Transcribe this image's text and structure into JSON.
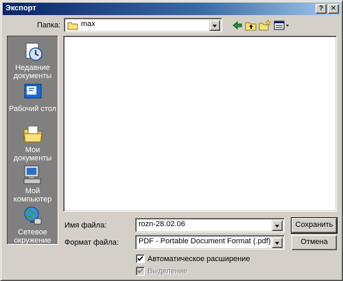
{
  "window": {
    "title": "Экспорт",
    "help_icon": "?",
    "close_icon": "✕"
  },
  "lookin": {
    "label": "Папка:",
    "value": "max",
    "icon": "folder-icon"
  },
  "toolbar": {
    "icons": [
      "back-arrow-icon",
      "up-folder-icon",
      "new-folder-icon",
      "view-menu-icon"
    ]
  },
  "places": [
    {
      "label": "Недавние документы",
      "icon": "recent-documents-icon"
    },
    {
      "label": "Рабочий стол",
      "icon": "desktop-icon"
    },
    {
      "label": "Мои документы",
      "icon": "my-documents-icon"
    },
    {
      "label": "Мой компьютер",
      "icon": "my-computer-icon"
    },
    {
      "label": "Сетевое окружение",
      "icon": "network-icon"
    }
  ],
  "filename": {
    "label": "Имя файла:",
    "value": "rozn-28.02.06"
  },
  "filetype": {
    "label": "Формат файла:",
    "value": "PDF - Portable Document Format (.pdf)"
  },
  "buttons": {
    "save": "Сохранить",
    "cancel": "Отмена"
  },
  "options": {
    "auto_extension": {
      "label": "Автоматическое расширение",
      "checked": true,
      "enabled": true
    },
    "selection": {
      "label": "Выделение",
      "checked": true,
      "enabled": false
    }
  }
}
